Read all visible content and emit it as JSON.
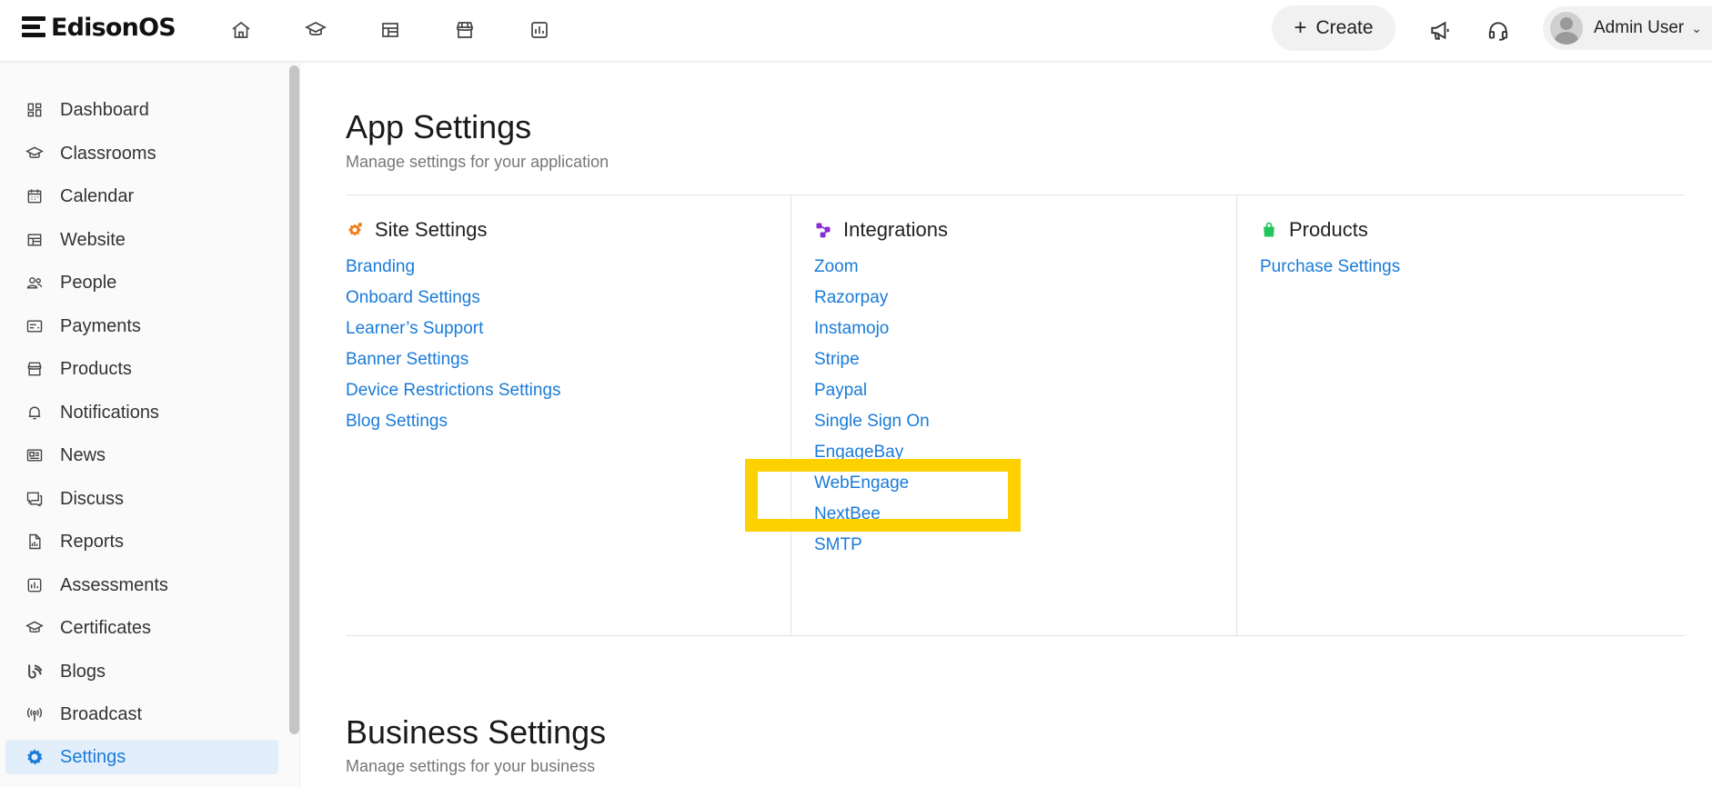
{
  "app": {
    "brand": "EdisonOS"
  },
  "topbar": {
    "nav_icons": [
      "home-icon",
      "graduation-cap-icon",
      "layout-icon",
      "store-icon",
      "chart-icon"
    ],
    "create_label": "Create",
    "user_name": "Admin User"
  },
  "sidebar": {
    "items": [
      {
        "label": "Dashboard",
        "icon": "dashboard-icon"
      },
      {
        "label": "Classrooms",
        "icon": "graduation-cap-icon"
      },
      {
        "label": "Calendar",
        "icon": "calendar-icon"
      },
      {
        "label": "Website",
        "icon": "layout-icon"
      },
      {
        "label": "People",
        "icon": "people-icon"
      },
      {
        "label": "Payments",
        "icon": "payments-icon"
      },
      {
        "label": "Products",
        "icon": "store-icon"
      },
      {
        "label": "Notifications",
        "icon": "bell-icon"
      },
      {
        "label": "News",
        "icon": "news-icon"
      },
      {
        "label": "Discuss",
        "icon": "chat-icon"
      },
      {
        "label": "Reports",
        "icon": "report-icon"
      },
      {
        "label": "Assessments",
        "icon": "chart-icon"
      },
      {
        "label": "Certificates",
        "icon": "graduation-cap-icon"
      },
      {
        "label": "Blogs",
        "icon": "blog-icon"
      },
      {
        "label": "Broadcast",
        "icon": "broadcast-icon"
      },
      {
        "label": "Settings",
        "icon": "gear-icon",
        "active": true
      }
    ]
  },
  "app_settings": {
    "title": "App Settings",
    "subtitle": "Manage settings for your application",
    "columns": [
      {
        "title": "Site Settings",
        "icon": "site-settings-icon",
        "links": [
          "Branding",
          "Onboard Settings",
          "Learner’s Support",
          "Banner Settings",
          "Device Restrictions Settings",
          "Blog Settings"
        ]
      },
      {
        "title": "Integrations",
        "icon": "integrations-icon",
        "links": [
          "Zoom",
          "Razorpay",
          "Instamojo",
          "Stripe",
          "Paypal",
          "Single Sign On",
          "EngageBay",
          "WebEngage",
          "NextBee",
          "SMTP"
        ]
      },
      {
        "title": "Products",
        "icon": "shopping-bag-icon",
        "links": [
          "Purchase Settings"
        ]
      }
    ]
  },
  "business_settings": {
    "title": "Business Settings",
    "subtitle": "Manage settings for your business"
  },
  "colors": {
    "accent": "#1a7bd8",
    "highlight": "#fdd000"
  }
}
